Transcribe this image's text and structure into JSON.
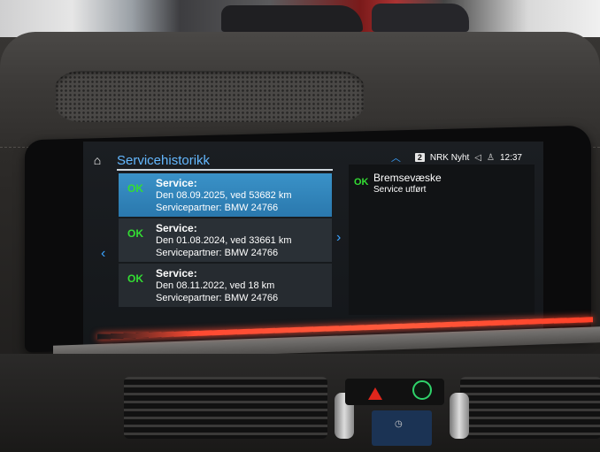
{
  "topbar": {
    "title": "Servicehistorikk",
    "channel_number": "2",
    "station": "NRK Nyht",
    "time": "12:37"
  },
  "services": [
    {
      "status": "OK",
      "label": "Service:",
      "date_line": "Den 08.09.2025, ved 53682 km",
      "partner_line": "Servicepartner: BMW 24766",
      "selected": true
    },
    {
      "status": "OK",
      "label": "Service:",
      "date_line": "Den 01.08.2024, ved 33661 km",
      "partner_line": "Servicepartner: BMW 24766",
      "selected": false
    },
    {
      "status": "OK",
      "label": "Service:",
      "date_line": "Den 08.11.2022, ved 18 km",
      "partner_line": "Servicepartner: BMW 24766",
      "selected": false
    }
  ],
  "detail": {
    "status": "OK",
    "name": "Bremsevæske",
    "sub": "Service utført"
  },
  "colors": {
    "accent": "#64b8ff",
    "ok_green": "#33dd33",
    "selected_row": "#2a78ad",
    "ambient_light": "#ff4a32"
  }
}
